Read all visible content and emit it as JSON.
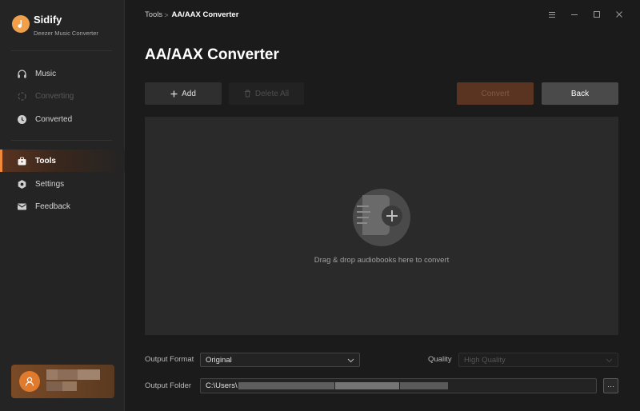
{
  "app": {
    "name": "Sidify",
    "subtitle": "Deezer Music Converter",
    "accent": "#f08a3a"
  },
  "sidebar": {
    "items": [
      {
        "label": "Music",
        "icon": "headphones-icon",
        "state": "normal"
      },
      {
        "label": "Converting",
        "icon": "spinner-icon",
        "state": "disabled"
      },
      {
        "label": "Converted",
        "icon": "clock-icon",
        "state": "normal"
      },
      {
        "label": "Tools",
        "icon": "toolbox-icon",
        "state": "active"
      },
      {
        "label": "Settings",
        "icon": "gear-icon",
        "state": "normal"
      },
      {
        "label": "Feedback",
        "icon": "envelope-icon",
        "state": "normal"
      }
    ]
  },
  "header": {
    "breadcrumb_root": "Tools",
    "breadcrumb_sep": ">",
    "breadcrumb_current": "AA/AAX Converter",
    "title": "AA/AAX Converter"
  },
  "toolbar": {
    "add_label": "Add",
    "delete_all_label": "Delete All",
    "convert_label": "Convert",
    "back_label": "Back"
  },
  "drop_zone": {
    "text": "Drag & drop audiobooks here to convert"
  },
  "output": {
    "format_label": "Output Format",
    "format_value": "Original",
    "quality_label": "Quality",
    "quality_value": "High Quality",
    "folder_label": "Output Folder",
    "folder_value": "C:\\Users\\",
    "browse_label": "···"
  }
}
